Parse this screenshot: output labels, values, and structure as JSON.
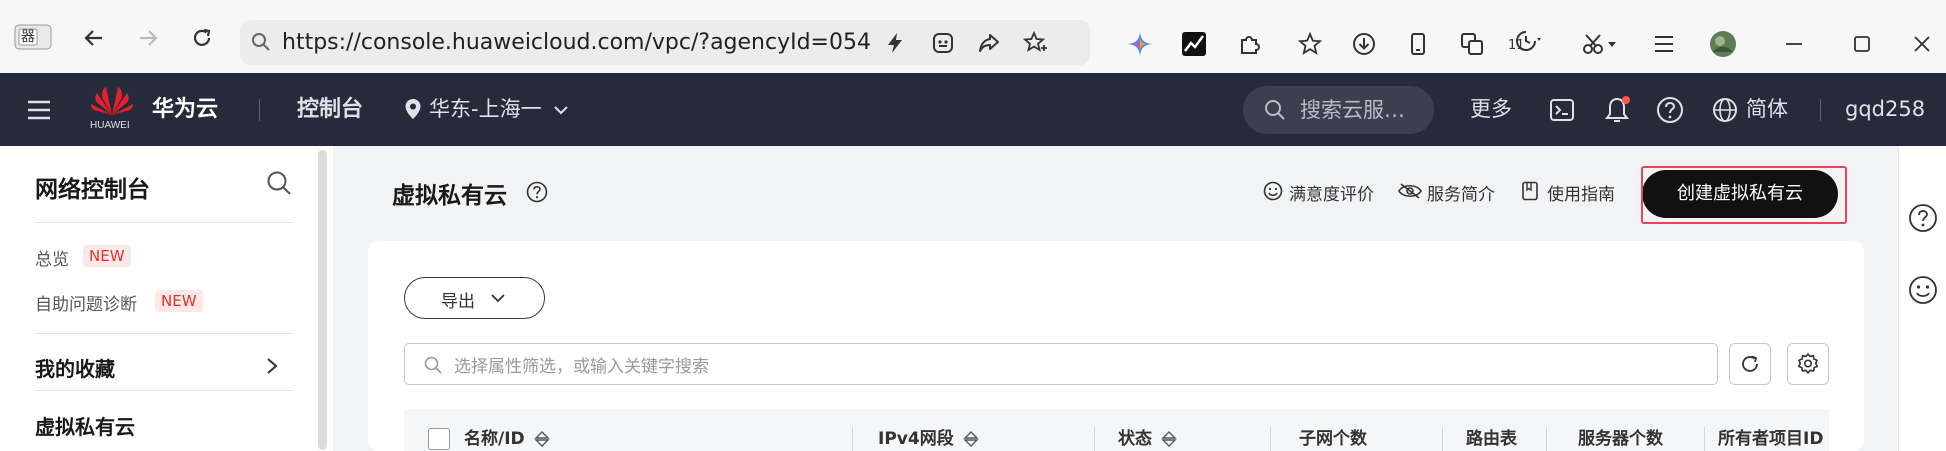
{
  "browser": {
    "url": "https://console.huaweicloud.com/vpc/?agencyId=054",
    "history_badge": "11",
    "tab_icon_text": "器"
  },
  "header": {
    "brand_text": "华为云",
    "logo_text": "HUAWEI",
    "console_label": "控制台",
    "region": "华东-上海一",
    "search_placeholder": "搜索云服…",
    "more_label": "更多",
    "language_label": "简体",
    "username": "gqd258"
  },
  "sidebar": {
    "title": "网络控制台",
    "items": [
      {
        "label": "总览",
        "badge": "NEW"
      },
      {
        "label": "自助问题诊断",
        "badge": "NEW"
      }
    ],
    "favorites_label": "我的收藏",
    "section_vpc": "虚拟私有云"
  },
  "main": {
    "page_title": "虚拟私有云",
    "links": {
      "rating": "满意度评价",
      "service_intro": "服务简介",
      "guide": "使用指南"
    },
    "create_button": "创建虚拟私有云",
    "export_button": "导出",
    "filter_placeholder": "选择属性筛选，或输入关键字搜索",
    "table_headers": [
      "名称/ID",
      "IPv4网段",
      "状态",
      "子网个数",
      "路由表",
      "服务器个数",
      "所有者项目ID"
    ]
  },
  "colors": {
    "header_bg": "#252b3a",
    "primary_button": "#111111",
    "highlight_frame": "#e7454f",
    "badge_text": "#e0332f",
    "badge_bg": "#fde8e8",
    "notification_dot": "#ff5a4a"
  }
}
